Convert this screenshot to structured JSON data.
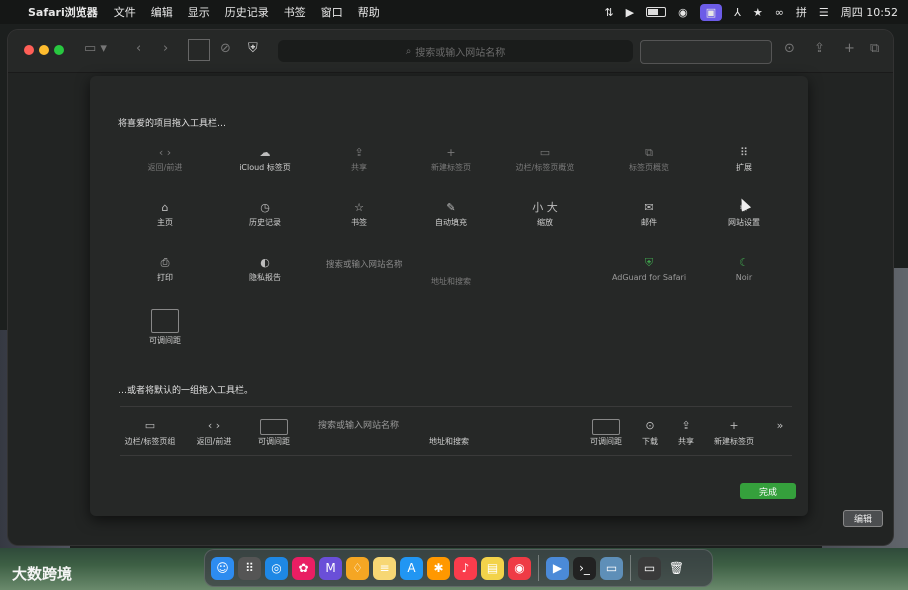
{
  "menubar": {
    "app": "Safari浏览器",
    "items": [
      "文件",
      "编辑",
      "显示",
      "历史记录",
      "书签",
      "窗口",
      "帮助"
    ],
    "input_method": "拼",
    "clock": "周四 10:52"
  },
  "toolbar": {
    "address_placeholder": "搜索或输入网站名称"
  },
  "sheet": {
    "title": "将喜爱的项目拖入工具栏…",
    "items": [
      {
        "label": "返回/前进",
        "icon": "‹ ›"
      },
      {
        "label": "iCloud 标签页",
        "icon": "☁"
      },
      {
        "label": "共享",
        "icon": "⇪"
      },
      {
        "label": "新建标签页",
        "icon": "+"
      },
      {
        "label": "边栏/标签页概览",
        "icon": "▭"
      },
      {
        "label": "标签页概览",
        "icon": "⧉"
      },
      {
        "label": "扩展",
        "icon": "⠿"
      },
      {
        "label": "主页",
        "icon": "⌂"
      },
      {
        "label": "历史记录",
        "icon": "◷"
      },
      {
        "label": "书签",
        "icon": "☆"
      },
      {
        "label": "自动填充",
        "icon": "✎"
      },
      {
        "label": "缩放",
        "icon": "小 大"
      },
      {
        "label": "邮件",
        "icon": "✉"
      },
      {
        "label": "网站设置",
        "icon": "⚙"
      },
      {
        "label": "打印",
        "icon": "⎙"
      },
      {
        "label": "隐私报告",
        "icon": "◐"
      },
      {
        "label": "地址和搜索",
        "icon": ""
      },
      {
        "label": "AdGuard for Safari",
        "icon": "⛨"
      },
      {
        "label": "Noir",
        "icon": "☾"
      },
      {
        "label": "可调间距",
        "icon": ""
      }
    ],
    "address_field_text": "搜索或输入网站名称",
    "subtitle": "…或者将默认的一组拖入工具栏。",
    "default_bar": [
      {
        "label": "边栏/标签页组",
        "icon": "▭"
      },
      {
        "label": "返回/前进",
        "icon": "‹ ›"
      },
      {
        "label": "可调间距",
        "icon": ""
      },
      {
        "label": "地址和搜索",
        "icon": ""
      },
      {
        "label": "可调间距",
        "icon": ""
      },
      {
        "label": "下载",
        "icon": "⊙"
      },
      {
        "label": "共享",
        "icon": "⇪"
      },
      {
        "label": "新建标签页",
        "icon": "+"
      },
      {
        "label": "",
        "icon": "»"
      }
    ],
    "default_search_text": "搜索或输入网站名称",
    "done_label": "完成"
  },
  "desktop": {
    "edit_label": "编辑"
  },
  "watermark": "大数跨境",
  "colors": {
    "accent_green": "#35a03c",
    "menubar_highlight": "#6c5ce7"
  }
}
